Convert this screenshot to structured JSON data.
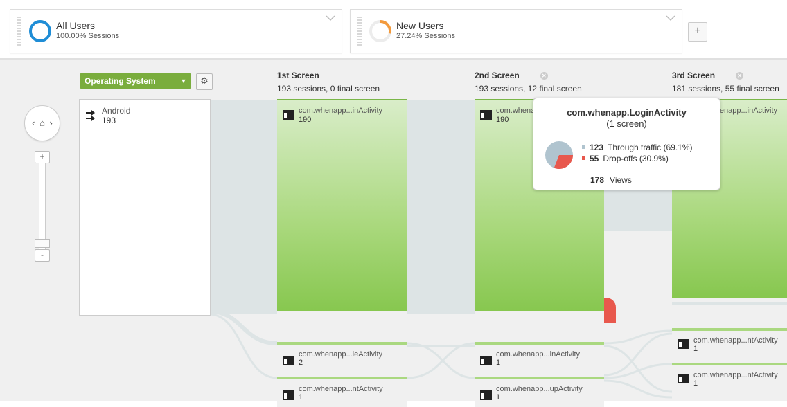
{
  "segments": [
    {
      "name": "All Users",
      "subtitle": "100.00% Sessions",
      "ring_color": "#1f8dd6",
      "percent": 100
    },
    {
      "name": "New Users",
      "subtitle": "27.24% Sessions",
      "ring_color": "#f39a3c",
      "percent": 27.24
    }
  ],
  "add_segment_label": "+",
  "controls": {
    "dimension_label": "Operating System",
    "gear_icon": "gear-icon",
    "home_icon": "home-icon",
    "zoom_in_label": "+",
    "zoom_out_label": "-",
    "home_left_arrow": "‹",
    "home_right_arrow": "›",
    "home_glyph": "⌂"
  },
  "source": {
    "label": "Android",
    "count": "193",
    "icon": "arrow-in-icon"
  },
  "columns": [
    {
      "title": "1st Screen",
      "summary": "193 sessions, 0 final screen"
    },
    {
      "title": "2nd Screen",
      "summary": "193 sessions, 12 final screen"
    },
    {
      "title": "3rd Screen",
      "summary": "181 sessions, 55 final screen"
    }
  ],
  "nodes": {
    "col1_main": {
      "name": "com.whenapp...inActivity",
      "count": "190"
    },
    "col2_main": {
      "name": "com.whenapp...inActivity",
      "count": "190"
    },
    "col3_main": {
      "name": "com.whenapp...inActivity",
      "count": ""
    },
    "col1_small": [
      {
        "name": "com.whenapp...leActivity",
        "count": "2"
      },
      {
        "name": "com.whenapp...ntActivity",
        "count": "1"
      }
    ],
    "col2_small": [
      {
        "name": "com.whenapp...inActivity",
        "count": "1"
      },
      {
        "name": "com.whenapp...upActivity",
        "count": "1"
      }
    ],
    "col3_small": [
      {
        "name": "com.whenapp...ntActivity",
        "count": "1"
      },
      {
        "name": "com.whenapp...ntActivity",
        "count": "1"
      }
    ]
  },
  "tooltip": {
    "title": "com.whenapp.LoginActivity",
    "subtitle": "(1 screen)",
    "through_count": "123",
    "through_label": "Through traffic (69.1%)",
    "through_color": "#b0c4cf",
    "dropoff_count": "55",
    "dropoff_label": "Drop-offs (30.9%)",
    "dropoff_color": "#e8584d",
    "views_count": "178",
    "views_label": "Views",
    "through_fraction": 0.691
  }
}
